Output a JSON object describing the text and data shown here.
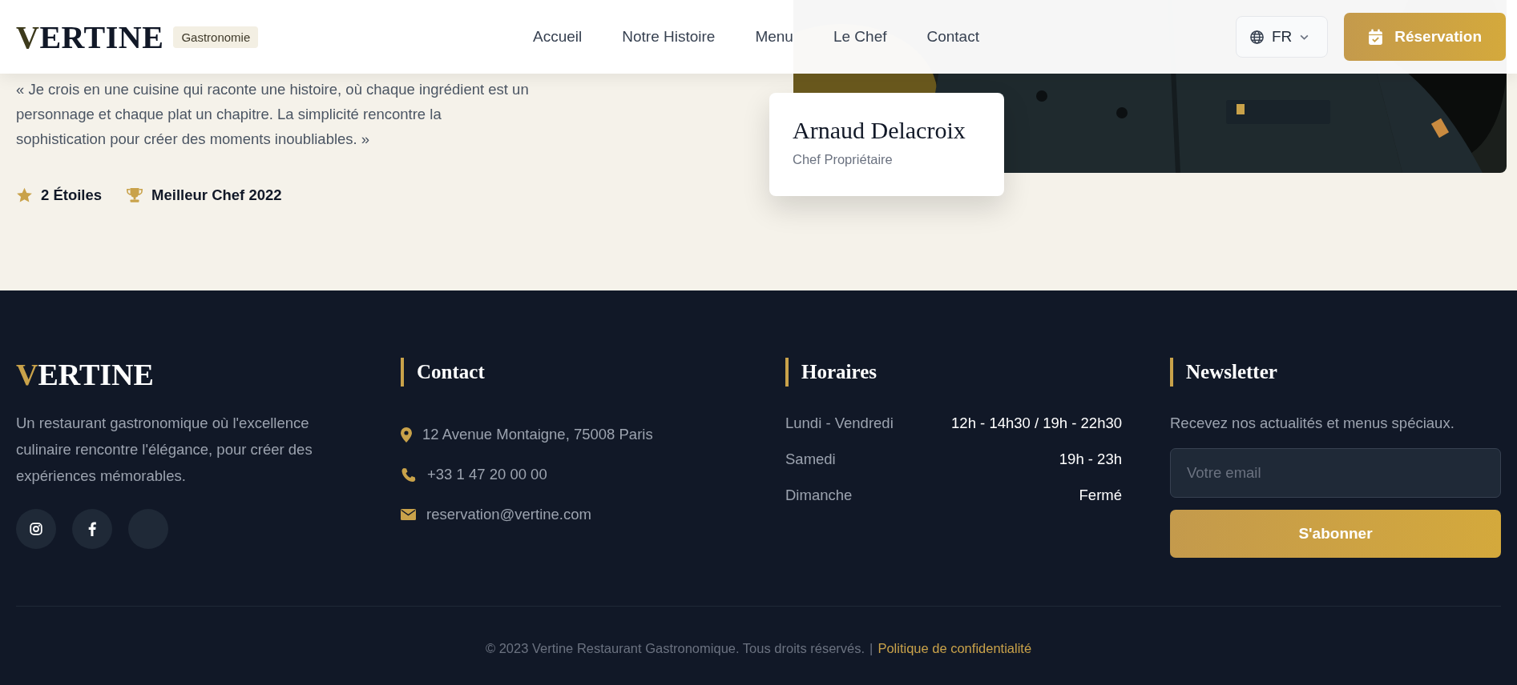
{
  "header": {
    "logo": "VERTINE",
    "badge": "Gastronomie",
    "nav": [
      {
        "label": "Accueil"
      },
      {
        "label": "Notre Histoire"
      },
      {
        "label": "Menu"
      },
      {
        "label": "Le Chef"
      },
      {
        "label": "Contact"
      }
    ],
    "language": "FR",
    "cta": "Réservation"
  },
  "chef": {
    "quote": "« Je crois en une cuisine qui raconte une histoire, où chaque ingrédient est un personnage et chaque plat un chapitre. La simplicité rencontre la sophistication pour créer des moments inoubliables. »",
    "awards": [
      {
        "kind": "star",
        "label": "2 Étoiles"
      },
      {
        "kind": "trophy",
        "label": "Meilleur Chef 2022"
      }
    ],
    "name": "Arnaud Delacroix",
    "role": "Chef Propriétaire"
  },
  "footer": {
    "logo": "VERTINE",
    "description": "Un restaurant gastronomique où l'excellence culinaire rencontre l'élégance, pour créer des expériences mémorables.",
    "socials": [
      {
        "kind": "instagram"
      },
      {
        "kind": "facebook"
      },
      {
        "kind": "blank"
      }
    ],
    "contact": {
      "title": "Contact",
      "items": [
        {
          "kind": "pin",
          "text": "12 Avenue Montaigne, 75008 Paris"
        },
        {
          "kind": "phone",
          "text": "+33 1 47 20 00 00"
        },
        {
          "kind": "mail",
          "text": "reservation@vertine.com"
        }
      ]
    },
    "hours": {
      "title": "Horaires",
      "rows": [
        {
          "day": "Lundi - Vendredi",
          "time": "12h - 14h30 / 19h - 22h30"
        },
        {
          "day": "Samedi",
          "time": "19h - 23h"
        },
        {
          "day": "Dimanche",
          "time": "Fermé"
        }
      ]
    },
    "newsletter": {
      "title": "Newsletter",
      "text": "Recevez nos actualités et menus spéciaux.",
      "placeholder": "Votre email",
      "button": "S'abonner"
    },
    "copyright": "© 2023 Vertine Restaurant Gastronomique. Tous droits réservés.",
    "separator": "|",
    "policy": "Politique de confidentialité"
  }
}
